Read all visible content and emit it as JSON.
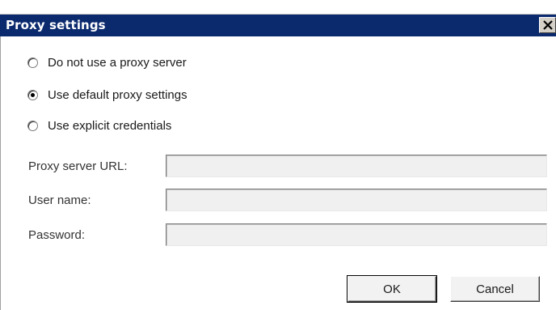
{
  "dialog": {
    "title": "Proxy settings",
    "close_icon": "close-icon"
  },
  "proxy_mode": {
    "options": [
      {
        "label": "Do not use a proxy server",
        "checked": false
      },
      {
        "label": "Use default proxy settings",
        "checked": true
      },
      {
        "label": "Use explicit credentials",
        "checked": false
      }
    ]
  },
  "fields": {
    "proxy_url": {
      "label": "Proxy server URL:",
      "value": ""
    },
    "username": {
      "label": "User name:",
      "value": ""
    },
    "password": {
      "label": "Password:",
      "value": ""
    }
  },
  "buttons": {
    "ok_label": "OK",
    "cancel_label": "Cancel"
  },
  "colors": {
    "titlebar": "#0b2a6e",
    "title_text": "#ffffff",
    "disabled_input": "#f0f0f0"
  }
}
